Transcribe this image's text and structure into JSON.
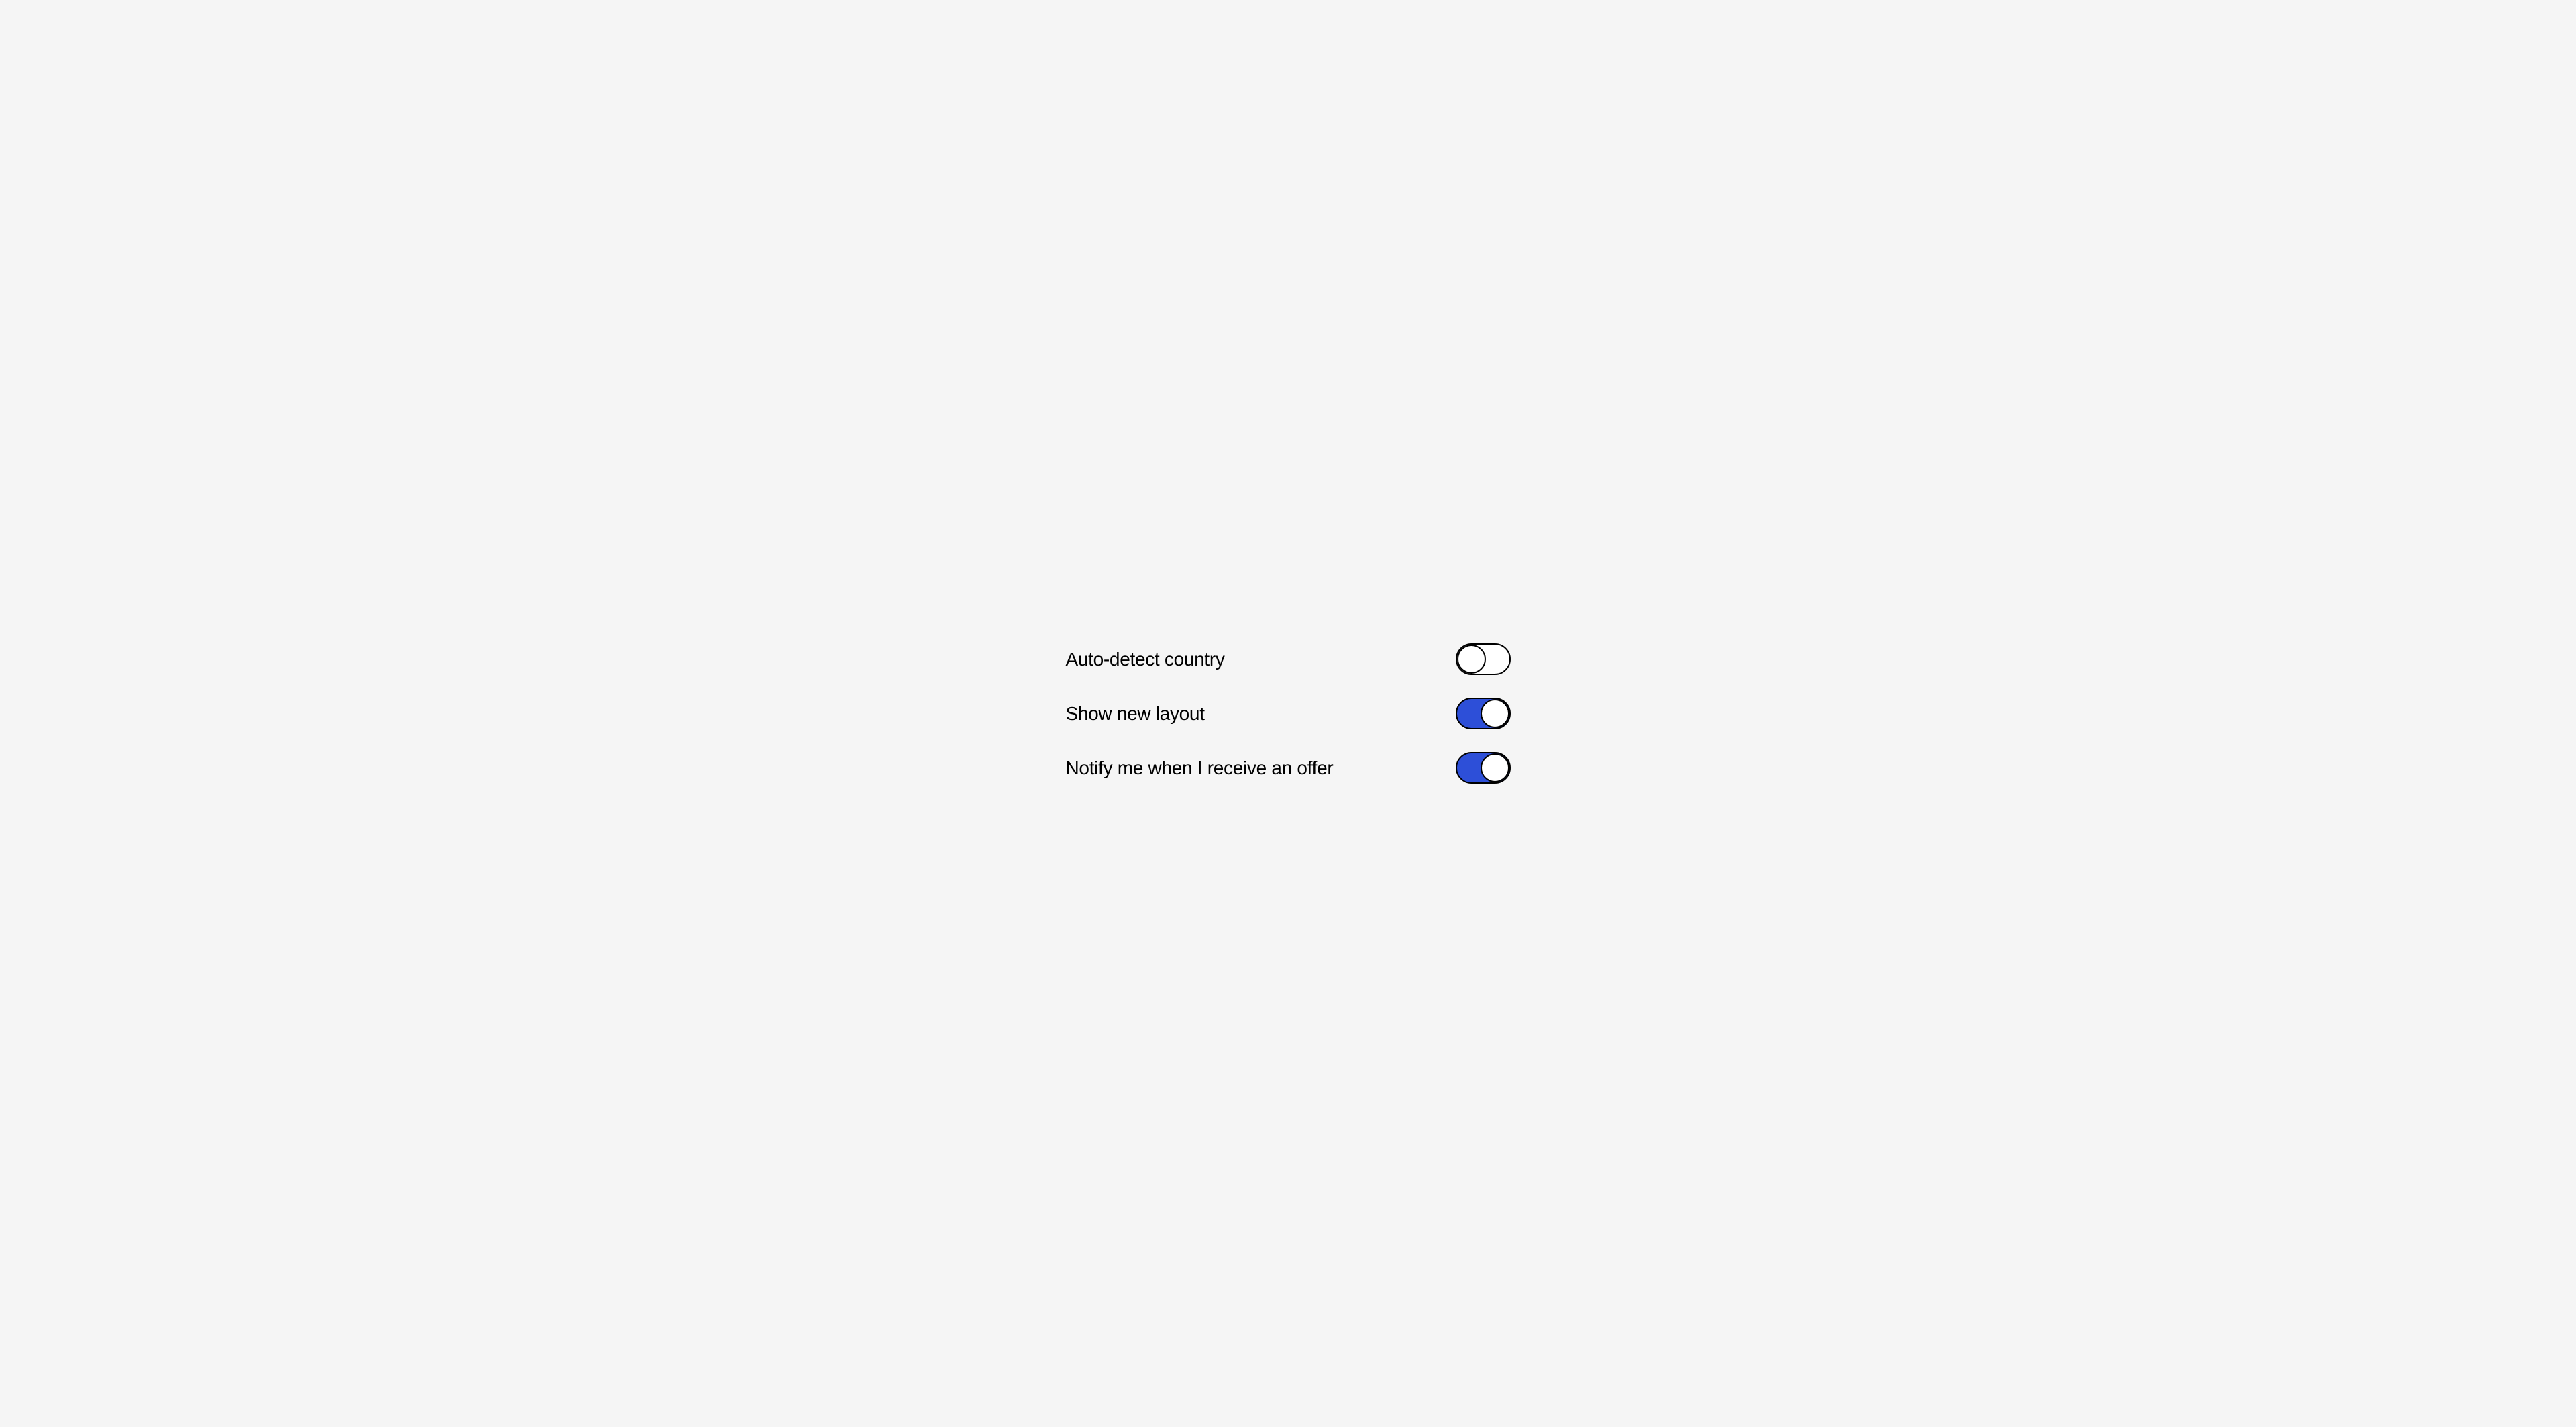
{
  "settings": [
    {
      "label": "Auto-detect country",
      "state": "off"
    },
    {
      "label": "Show new layout",
      "state": "on"
    },
    {
      "label": "Notify me when I receive an offer",
      "state": "on"
    }
  ],
  "colors": {
    "toggle_on": "#2d4fd8",
    "background": "#f5f5f5"
  }
}
